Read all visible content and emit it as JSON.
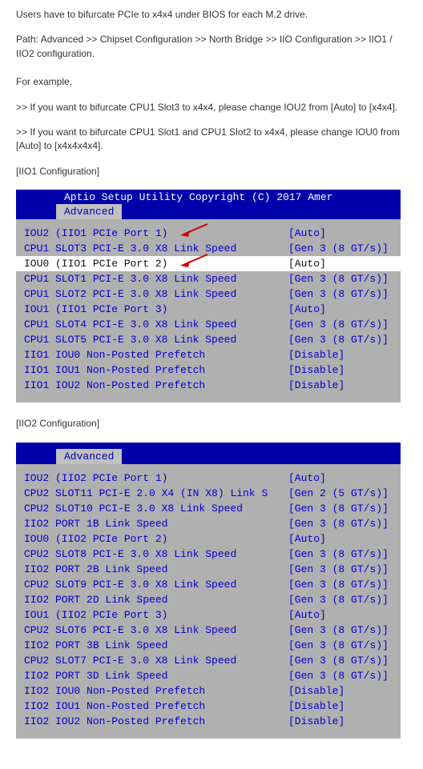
{
  "intro": {
    "line1": "Users have to bifurcate PCIe to x4x4 under BIOS for each M.2 drive.",
    "line2": "Path: Advanced >> Chipset Configuration >> North Bridge >> IIO Configuration >> IIO1 / IIO2 configuration.",
    "line3": "For example,",
    "line4": ">> If you want to bifurcate CPU1 Slot3 to x4x4, please change IOU2 from [Auto] to [x4x4].",
    "line5": ">> If you want to bifurcate CPU1 Slot1 and CPU1 Slot2 to x4x4, please change IOU0 from [Auto] to [x4x4x4x4].",
    "label_iio1": "[IIO1 Configuration]",
    "label_iio2": "[IIO2 Configuration]"
  },
  "bios": {
    "topbar": "Aptio Setup Utility   Copyright (C) 2017 Amer",
    "tab": "Advanced"
  },
  "iio1": {
    "rows": [
      {
        "label": "IOU2 (IIO1 PCIe Port 1)",
        "value": "[Auto]",
        "selected": false
      },
      {
        "label": "CPU1 SLOT3 PCI-E 3.0 X8 Link Speed",
        "value": "[Gen 3 (8 GT/s)]",
        "selected": false
      },
      {
        "label": "IOU0 (IIO1 PCIe Port 2)",
        "value": "[Auto]",
        "selected": true
      },
      {
        "label": "CPU1 SLOT1 PCI-E 3.0 X8 Link Speed",
        "value": "[Gen 3 (8 GT/s)]",
        "selected": false
      },
      {
        "label": "CPU1 SLOT2 PCI-E 3.0 X8 Link Speed",
        "value": "[Gen 3 (8 GT/s)]",
        "selected": false
      },
      {
        "label": "IOU1 (IIO1 PCIe Port 3)",
        "value": "[Auto]",
        "selected": false
      },
      {
        "label": "CPU1 SLOT4 PCI-E 3.0 X8 Link Speed",
        "value": "[Gen 3 (8 GT/s)]",
        "selected": false
      },
      {
        "label": "CPU1 SLOT5 PCI-E 3.0 X8 Link Speed",
        "value": "[Gen 3 (8 GT/s)]",
        "selected": false
      },
      {
        "label": "IIO1 IOU0 Non-Posted Prefetch",
        "value": "[Disable]",
        "selected": false
      },
      {
        "label": "IIO1 IOU1 Non-Posted Prefetch",
        "value": "[Disable]",
        "selected": false
      },
      {
        "label": "IIO1 IOU2 Non-Posted Prefetch",
        "value": "[Disable]",
        "selected": false
      }
    ]
  },
  "iio2": {
    "rows": [
      {
        "label": "IOU2 (IIO2 PCIe Port 1)",
        "value": "[Auto]",
        "selected": false
      },
      {
        "label": "CPU2 SLOT11 PCI-E 2.0 X4 (IN X8) Link S",
        "value": "[Gen 2 (5 GT/s)]",
        "selected": false
      },
      {
        "label": "CPU2 SLOT10 PCI-E 3.0 X8 Link Speed",
        "value": "[Gen 3 (8 GT/s)]",
        "selected": false
      },
      {
        "label": "IIO2 PORT 1B Link Speed",
        "value": "[Gen 3 (8 GT/s)]",
        "selected": false
      },
      {
        "label": "IOU0 (IIO2 PCIe Port 2)",
        "value": "[Auto]",
        "selected": false
      },
      {
        "label": "CPU2 SLOT8 PCI-E 3.0 X8 Link Speed",
        "value": "[Gen 3 (8 GT/s)]",
        "selected": false
      },
      {
        "label": "IIO2 PORT 2B Link Speed",
        "value": "[Gen 3 (8 GT/s)]",
        "selected": false
      },
      {
        "label": "CPU2 SLOT9 PCI-E 3.0 X8 Link Speed",
        "value": "[Gen 3 (8 GT/s)]",
        "selected": false
      },
      {
        "label": "IIO2 PORT 2D Link Speed",
        "value": "[Gen 3 (8 GT/s)]",
        "selected": false
      },
      {
        "label": "IOU1 (IIO2 PCIe Port 3)",
        "value": "[Auto]",
        "selected": false
      },
      {
        "label": "CPU2 SLOT6 PCI-E 3.0 X8 Link Speed",
        "value": "[Gen 3 (8 GT/s)]",
        "selected": false
      },
      {
        "label": "IIO2 PORT 3B Link Speed",
        "value": "[Gen 3 (8 GT/s)]",
        "selected": false
      },
      {
        "label": "CPU2 SLOT7 PCI-E 3.0 X8 Link Speed",
        "value": "[Gen 3 (8 GT/s)]",
        "selected": false
      },
      {
        "label": "IIO2 PORT 3D Link Speed",
        "value": "[Gen 3 (8 GT/s)]",
        "selected": false
      },
      {
        "label": "IIO2 IOU0 Non-Posted Prefetch",
        "value": "[Disable]",
        "selected": false
      },
      {
        "label": "IIO2 IOU1 Non-Posted Prefetch",
        "value": "[Disable]",
        "selected": false
      },
      {
        "label": "IIO2 IOU2 Non-Posted Prefetch",
        "value": "[Disable]",
        "selected": false
      }
    ]
  }
}
